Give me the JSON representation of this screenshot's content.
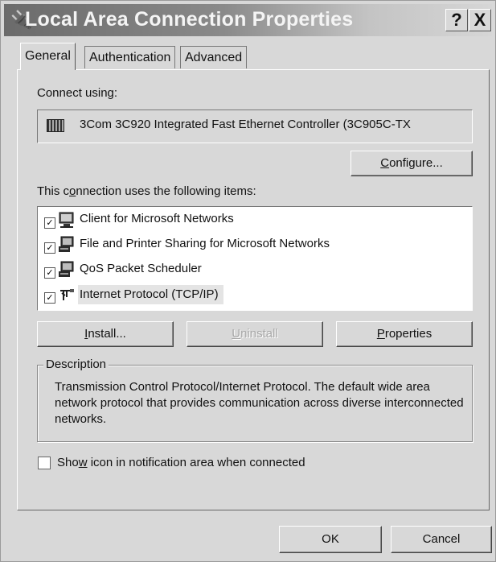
{
  "window": {
    "title": "Local Area Connection Properties",
    "help_label": "?",
    "close_label": "X"
  },
  "tabs": [
    {
      "label": "General",
      "active": true
    },
    {
      "label": "Authentication",
      "active": false
    },
    {
      "label": "Advanced",
      "active": false
    }
  ],
  "connect_using": {
    "label": "Connect using:",
    "adapter": "3Com 3C920 Integrated Fast Ethernet Controller (3C905C-TX"
  },
  "buttons": {
    "configure_pre": "C",
    "configure_rest": "onfigure...",
    "install_pre": "I",
    "install_rest": "nstall...",
    "uninstall_pre": "U",
    "uninstall_rest": "ninstall",
    "properties_pre": "P",
    "properties_rest": "roperties",
    "ok": "OK",
    "cancel": "Cancel"
  },
  "items_label_a": "This c",
  "items_label_u": "o",
  "items_label_b": "nnection uses the following items:",
  "items": [
    {
      "label": "Client for Microsoft Networks",
      "checked": true,
      "icon": "client-network-icon"
    },
    {
      "label": "File and Printer Sharing for Microsoft Networks",
      "checked": true,
      "icon": "file-printer-sharing-icon"
    },
    {
      "label": "QoS Packet Scheduler",
      "checked": true,
      "icon": "qos-scheduler-icon"
    },
    {
      "label": "Internet Protocol (TCP/IP)",
      "checked": true,
      "icon": "tcpip-protocol-icon",
      "selected": true
    }
  ],
  "description": {
    "legend": "Description",
    "text": "Transmission Control Protocol/Internet Protocol. The default wide area network protocol that provides communication across diverse interconnected networks."
  },
  "show_icon": {
    "pre": "Sho",
    "u": "w",
    "post": " icon in notification area when connected",
    "checked": false
  }
}
